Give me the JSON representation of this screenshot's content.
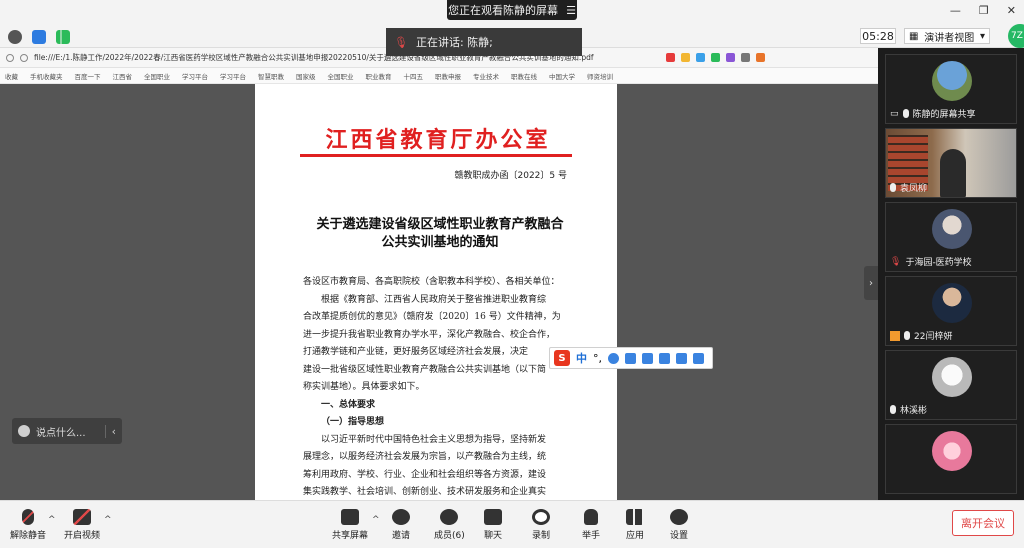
{
  "share_banner": {
    "text": "您正在观看陈静的屏幕"
  },
  "topbar": {
    "speaker_text": "正在讲话: 陈静;",
    "timer": "05:28",
    "view_label": "演讲者视图",
    "avatar_text": "7Z"
  },
  "browser": {
    "url": "file:///E:/1.陈静工作/2022年/2022春/江西省医药学校区域性产教融合公共实训基地申报20220510/关于遴选建设省级区域性职业教育产教融合公共实训基地的通知.pdf",
    "bookmarks": [
      "收藏",
      "手机收藏夹",
      "百度一下",
      "江西省",
      "全国职业",
      "学习平台",
      "学习平台",
      "智慧职教",
      "国家级",
      "全国职业",
      "职业教育",
      "十四五",
      "职教申报",
      "专业技术",
      "职教在线",
      "中国大学",
      "师资培训"
    ]
  },
  "document": {
    "header_title": "江西省教育厅办公室",
    "doc_number": "赣教职成办函〔2022〕5 号",
    "notice_title_line1": "关于遴选建设省级区域性职业教育产教融合",
    "notice_title_line2": "公共实训基地的通知",
    "lines": [
      "各设区市教育局、各高职院校（含职教本科学校）、各相关单位：",
      "根据《教育部、江西省人民政府关于整省推进职业教育综",
      "合改革提质创优的意见》（赣府发〔2020〕16 号）文件精神，为",
      "进一步提升我省职业教育办学水平，深化产教融合、校企合作，",
      "打通教学链和产业链，更好服务区域经济社会发展，决定",
      "建设一批省级区域性职业教育产教融合公共实训基地（以下简",
      "称实训基地）。具体要求如下。",
      "一、总体要求",
      "（一）指导思想",
      "以习近平新时代中国特色社会主义思想为指导，坚持新发",
      "展理念，以服务经济社会发展为宗旨，以产教融合为主线，统",
      "筹利用政府、学校、行业、企业和社会组织等各方资源，建设",
      "集实践教学、社会培训、创新创业、技术研发服务和企业真实"
    ]
  },
  "ime": {
    "logo": "S",
    "mode": "中",
    "punct": "°,"
  },
  "chat": {
    "placeholder": "说点什么..."
  },
  "participants": [
    {
      "name": "陈静的屏幕共享"
    },
    {
      "name": "袁凤柳"
    },
    {
      "name": "于海园-医药学校"
    },
    {
      "name": "22闫梓妍"
    },
    {
      "name": "林溪彬"
    },
    {
      "name": ""
    }
  ],
  "toolbar": {
    "unmute": "解除静音",
    "start_video": "开启视频",
    "share_screen": "共享屏幕",
    "invite": "邀请",
    "members": "成员(6)",
    "chat": "聊天",
    "record": "录制",
    "raise_hand": "举手",
    "apps": "应用",
    "settings": "设置",
    "leave": "离开会议"
  }
}
